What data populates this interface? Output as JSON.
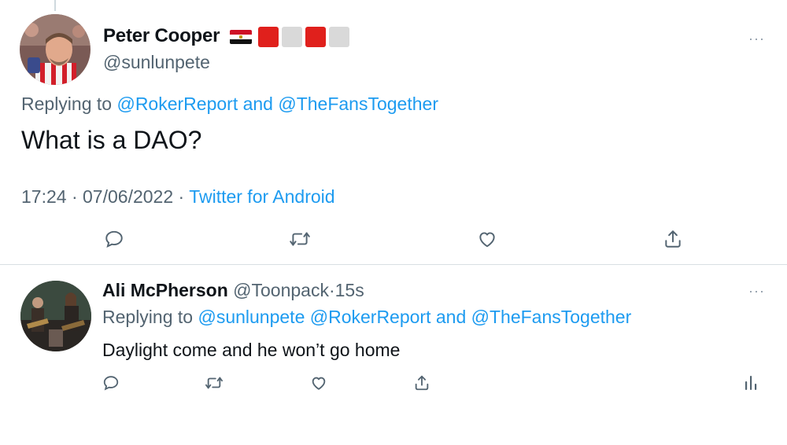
{
  "main_tweet": {
    "author_name": "Peter Cooper",
    "author_handle": "@sunlunpete",
    "replying_prefix": "Replying to",
    "replying_mention_1": "@RokerReport",
    "replying_and": "and",
    "replying_mention_2": "@TheFansTogether",
    "text": "What is a DAO?",
    "time": "17:24",
    "date": "07/06/2022",
    "separator": "·",
    "source": "Twitter for Android",
    "more_label": "···"
  },
  "reply_tweet": {
    "author_name": "Ali McPherson",
    "author_handle": "@Toonpack",
    "separator": "·",
    "timestamp": "15s",
    "replying_prefix": "Replying to",
    "replying_mention_1": "@sunlunpete",
    "replying_mention_2": "@RokerReport",
    "replying_and": "and",
    "replying_mention_3": "@TheFansTogether",
    "text": "Daylight come and he won’t go home",
    "more_label": "···"
  },
  "icons": {
    "reply": "reply-icon",
    "retweet": "retweet-icon",
    "like": "like-icon",
    "share": "share-icon",
    "analytics": "analytics-icon"
  },
  "colors": {
    "accent": "#1d9bf0",
    "secondary_text": "#536471",
    "primary_text": "#0f1419",
    "flag_red": "#e0201c",
    "flag_grey": "#d9d9d9"
  }
}
